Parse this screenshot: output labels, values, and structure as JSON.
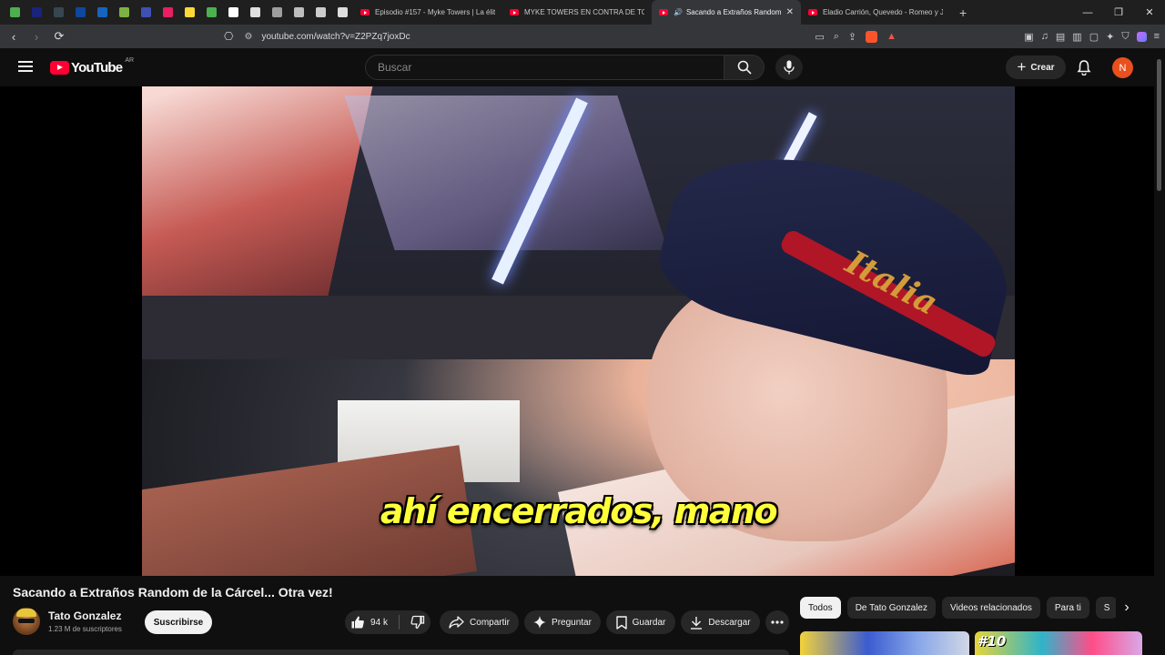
{
  "browser": {
    "tabs": [
      {
        "title": "Episodio #157 - Myke Towers | La élit",
        "active": false
      },
      {
        "title": "MYKE TOWERS EN CONTRA DE TODO",
        "active": false
      },
      {
        "title": "Sacando a Extraños Random",
        "active": true
      },
      {
        "title": "Eladio Carrión, Quevedo - Romeo y J",
        "active": false
      }
    ],
    "url": "youtube.com/watch?v=Z2PZq7joxDc",
    "pinned_colors": [
      "#4caf50",
      "#1a237e",
      "#37474f",
      "#0d47a1",
      "#1565c0",
      "#7cb342",
      "#3f51b5",
      "#e91e63",
      "#fdd835",
      "#4caf50",
      "#ffffff",
      "#e0e0e0",
      "#9e9e9e",
      "#bdbdbd",
      "#cccccc",
      "#dddddd"
    ]
  },
  "youtube": {
    "logo_text": "YouTube",
    "country_code": "AR",
    "search_placeholder": "Buscar",
    "create_label": "Crear",
    "avatar_letter": "N"
  },
  "video": {
    "subtitle": "ahí encerrados, mano",
    "title": "Sacando a Extraños Random de la Cárcel... Otra vez!",
    "channel_name": "Tato Gonzalez",
    "subscribers": "1.23 M de suscriptores",
    "subscribe_label": "Suscribirse",
    "likes": "94 k",
    "share_label": "Compartir",
    "ask_label": "Preguntar",
    "save_label": "Guardar",
    "download_label": "Descargar"
  },
  "chips": [
    "Todos",
    "De Tato Gonzalez",
    "Videos relacionados",
    "Para ti",
    "S"
  ],
  "recommendations": {
    "thumb2_badge": "#10"
  },
  "colors": {
    "youtube_red": "#ff0033",
    "background": "#0f0f0f",
    "subtitle_yellow": "#ffff3a",
    "avatar_orange": "#e8501d"
  }
}
